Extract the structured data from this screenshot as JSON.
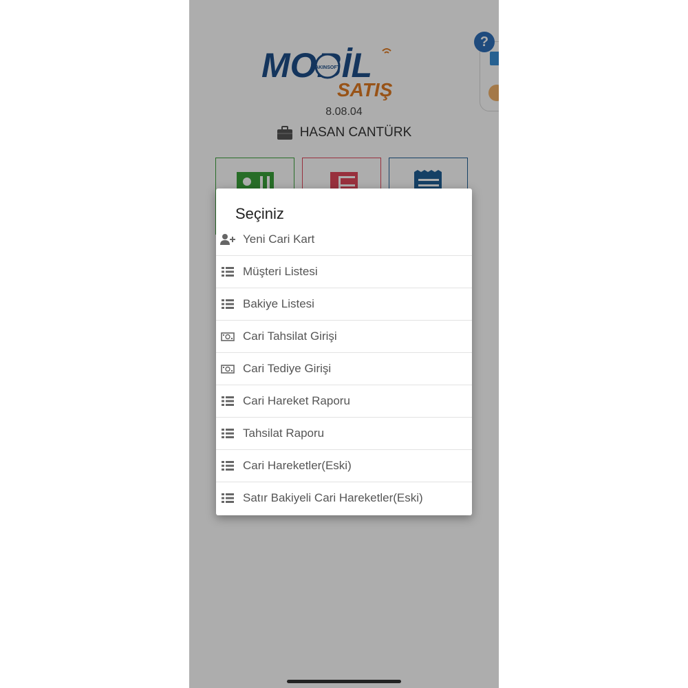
{
  "app": {
    "logo_line1": "MOBİL",
    "logo_brand": "AKINSOFT",
    "logo_line2": "SATIŞ",
    "version": "8.08.04",
    "user_name": "HASAN CANTÜRK"
  },
  "help": {
    "label": "?"
  },
  "dialog": {
    "title": "Seçiniz",
    "items": [
      {
        "label": "Yeni Cari Kart",
        "icon": "add-user-icon"
      },
      {
        "label": "Müşteri Listesi",
        "icon": "list-icon"
      },
      {
        "label": "Bakiye Listesi",
        "icon": "list-icon"
      },
      {
        "label": "Cari Tahsilat Girişi",
        "icon": "money-icon"
      },
      {
        "label": "Cari Tediye Girişi",
        "icon": "money-icon"
      },
      {
        "label": "Cari Hareket Raporu",
        "icon": "list-icon"
      },
      {
        "label": "Tahsilat Raporu",
        "icon": "list-icon"
      },
      {
        "label": "Cari Hareketler(Eski)",
        "icon": "list-icon"
      },
      {
        "label": "Satır Bakiyeli Cari Hareketler(Eski)",
        "icon": "list-icon"
      }
    ]
  },
  "colors": {
    "logo_blue": "#1e4f8a",
    "logo_orange": "#e07b22",
    "tile_green": "#3aa13a",
    "tile_red": "#e0475b",
    "tile_blue": "#1f5f95"
  }
}
